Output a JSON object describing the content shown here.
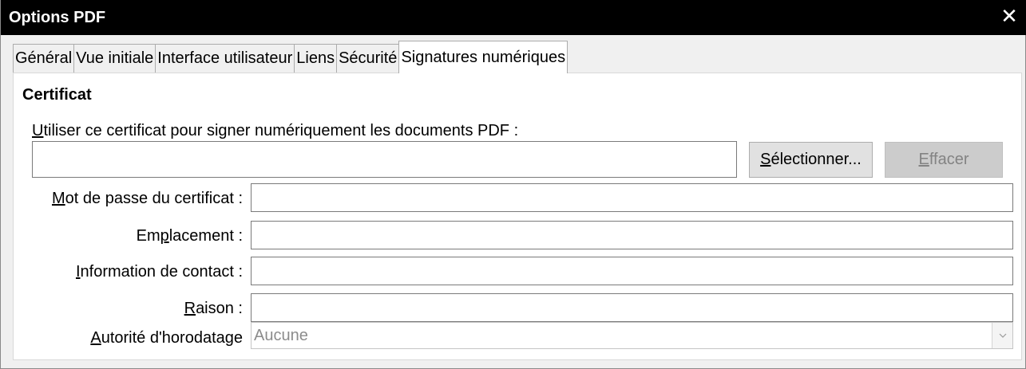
{
  "window": {
    "title": "Options PDF",
    "close_icon": "close-icon"
  },
  "tabs": [
    {
      "label": "Général",
      "active": false
    },
    {
      "label": "Vue initiale",
      "active": false
    },
    {
      "label": "Interface utilisateur",
      "active": false
    },
    {
      "label": "Liens",
      "active": false
    },
    {
      "label": "Sécurité",
      "active": false
    },
    {
      "label": "Signatures numériques",
      "active": true
    }
  ],
  "certificate": {
    "section_title": "Certificat",
    "use_label_key": "U",
    "use_label_rest": "tiliser ce certificat pour signer numériquement les documents PDF :",
    "certificate_value": "",
    "select_label_key": "S",
    "select_label_rest": "électionner...",
    "clear_label_key": "E",
    "clear_label_rest": "ffacer"
  },
  "fields": {
    "password": {
      "label_key": "M",
      "label_rest": "ot de passe du certificat :",
      "value": ""
    },
    "location": {
      "label_pre": "Em",
      "label_key": "p",
      "label_rest": "lacement :",
      "value": ""
    },
    "contact": {
      "label_key": "I",
      "label_rest": "nformation de contact :",
      "value": ""
    },
    "reason": {
      "label_key": "R",
      "label_rest": "aison :",
      "value": ""
    },
    "tsa": {
      "label_key": "A",
      "label_rest": "utorité d'horodatage",
      "value": "Aucune"
    }
  },
  "colors": {
    "titlebar_bg": "#000000",
    "titlebar_text": "#ffffff",
    "panel_bg": "#ffffff",
    "disabled_button_bg": "#cccccc"
  }
}
